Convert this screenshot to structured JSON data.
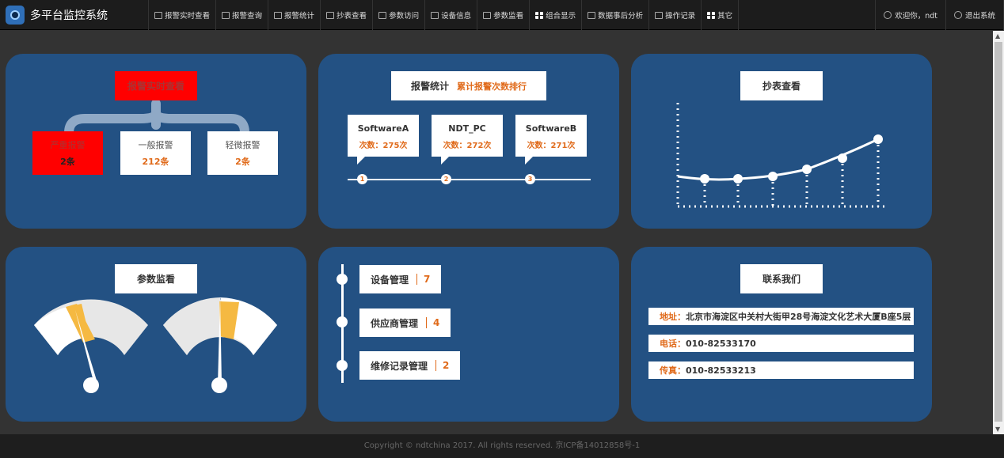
{
  "app": {
    "title": "多平台监控系统"
  },
  "nav": [
    {
      "label": "报警实时查看",
      "icon": "monitor-icon"
    },
    {
      "label": "报警查询",
      "icon": "speaker-icon"
    },
    {
      "label": "报警统计",
      "icon": "chart-icon"
    },
    {
      "label": "抄表查看",
      "icon": "table-icon"
    },
    {
      "label": "参数访问",
      "icon": "list-icon"
    },
    {
      "label": "设备信息",
      "icon": "bar-chart-icon"
    },
    {
      "label": "参数监看",
      "icon": "tools-icon"
    },
    {
      "label": "组合显示",
      "icon": "grid-icon"
    },
    {
      "label": "数据事后分析",
      "icon": "chart-icon"
    },
    {
      "label": "操作记录",
      "icon": "list-icon"
    },
    {
      "label": "其它",
      "icon": "grid-icon"
    }
  ],
  "user": {
    "welcome": "欢迎你，ndt",
    "logout": "退出系统"
  },
  "alarm_realtime": {
    "title": "报警实时查看",
    "boxes": [
      {
        "label": "严重报警",
        "count": "2条"
      },
      {
        "label": "一般报警",
        "count": "212条"
      },
      {
        "label": "轻微报警",
        "count": "2条"
      }
    ]
  },
  "alarm_stats": {
    "title": "报警统计",
    "subtitle": "累计报警次数排行",
    "items": [
      {
        "name": "SoftwareA",
        "count": "次数：275次",
        "rank": "1"
      },
      {
        "name": "NDT_PC",
        "count": "次数：272次",
        "rank": "2"
      },
      {
        "name": "SoftwareB",
        "count": "次数：271次",
        "rank": "3"
      }
    ]
  },
  "meter_view": {
    "title": "抄表查看"
  },
  "param_monitor": {
    "title": "参数监看"
  },
  "management": {
    "items": [
      {
        "label": "设备管理",
        "count": "7"
      },
      {
        "label": "供应商管理",
        "count": "4"
      },
      {
        "label": "维修记录管理",
        "count": "2"
      }
    ]
  },
  "contact": {
    "title": "联系我们",
    "address_key": "地址：",
    "address": "北京市海淀区中关村大街甲28号海淀文化艺术大厦B座5层",
    "phone_key": "电话：",
    "phone": "010-82533170",
    "fax_key": "传真：",
    "fax": "010-82533213"
  },
  "footer": {
    "text": "Copyright © ndtchina 2017. All rights reserved. 京ICP备14012858号-1"
  },
  "colors": {
    "card": "#235183",
    "accent": "#e06a1a",
    "alarm": "#ff0000",
    "gauge_highlight": "#f5b942"
  }
}
